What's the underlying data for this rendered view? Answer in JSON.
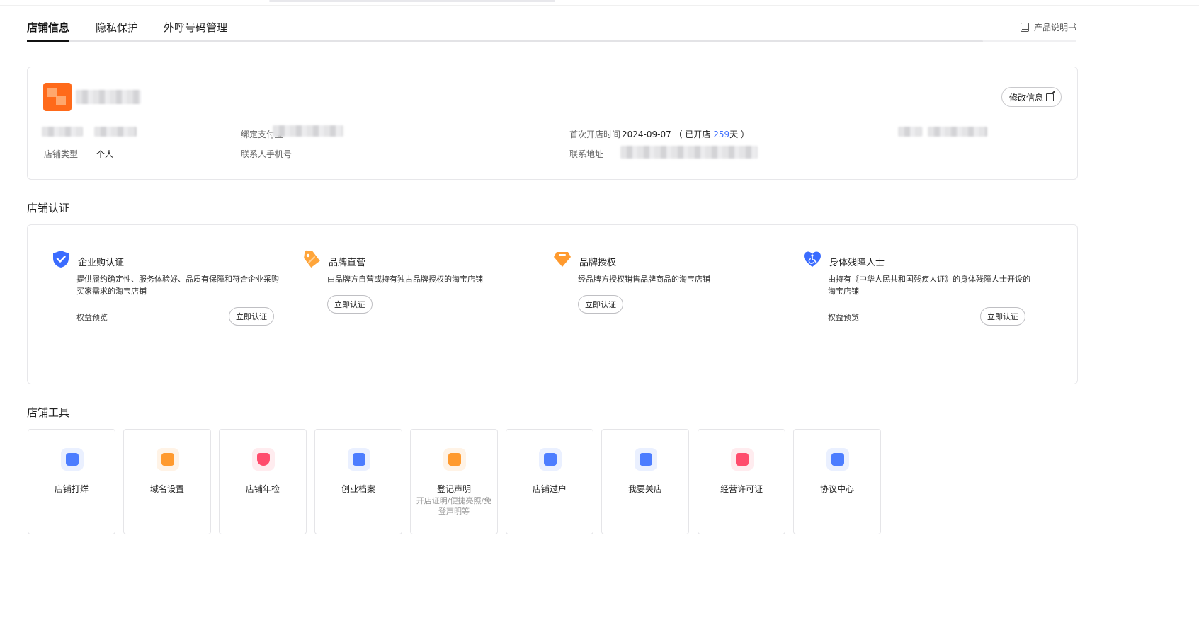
{
  "tabs": {
    "items": [
      {
        "label": "店铺信息"
      },
      {
        "label": "隐私保护"
      },
      {
        "label": "外呼号码管理"
      }
    ],
    "manual_label": "产品说明书"
  },
  "shop_info": {
    "edit_label": "修改信息",
    "bind_alipay_label": "绑定支付宝",
    "first_open_label": "首次开店时间",
    "first_open_date": "2024-09-07",
    "open_prefix": "（ 已开店 ",
    "open_days": "259",
    "open_suffix": "天 ）",
    "shop_type_label": "店铺类型",
    "shop_type_value": "个人",
    "contact_phone_label": "联系人手机号",
    "address_label": "联系地址"
  },
  "certification": {
    "section_title": "店铺认证",
    "items": [
      {
        "title": "企业购认证",
        "desc": "提供履约确定性、服务体验好、品质有保障和符合企业采购买家需求的淘宝店铺",
        "benefit": "权益预览",
        "button": "立即认证",
        "icon": "shield-check-icon",
        "color": "#3b6cff"
      },
      {
        "title": "品牌直营",
        "desc": "由品牌方自营或持有独占品牌授权的淘宝店铺",
        "benefit": "",
        "button": "立即认证",
        "icon": "tag-icon",
        "color": "#ff9a2e"
      },
      {
        "title": "品牌授权",
        "desc": "经品牌方授权销售品牌商品的淘宝店铺",
        "benefit": "",
        "button": "立即认证",
        "icon": "diamond-icon",
        "color": "#ff9a2e"
      },
      {
        "title": "身体残障人士",
        "desc": "由持有《中华人民共和国残疾人证》的身体残障人士开设的淘宝店铺",
        "benefit": "权益预览",
        "button": "立即认证",
        "icon": "accessibility-heart-icon",
        "color": "#3b6cff"
      }
    ]
  },
  "tools": {
    "section_title": "店铺工具",
    "items": [
      {
        "label": "店铺打烊",
        "sub": "",
        "icon": "shop-closed-icon",
        "color": "#4c7dff"
      },
      {
        "label": "域名设置",
        "sub": "",
        "icon": "domain-icon",
        "color": "#ff9a2e"
      },
      {
        "label": "店铺年检",
        "sub": "",
        "icon": "inspection-shield-icon",
        "color": "#ff4d6d"
      },
      {
        "label": "创业档案",
        "sub": "",
        "icon": "archive-icon",
        "color": "#4c7dff"
      },
      {
        "label": "登记声明",
        "sub": "开店证明/便捷亮照/免登声明等",
        "icon": "registration-doc-icon",
        "color": "#ff9a2e"
      },
      {
        "label": "店铺过户",
        "sub": "",
        "icon": "transfer-icon",
        "color": "#4c7dff"
      },
      {
        "label": "我要关店",
        "sub": "",
        "icon": "close-shop-icon",
        "color": "#4c7dff"
      },
      {
        "label": "经营许可证",
        "sub": "",
        "icon": "license-folder-icon",
        "color": "#ff4d6d"
      },
      {
        "label": "协议中心",
        "sub": "",
        "icon": "agreement-icon",
        "color": "#4c7dff"
      }
    ]
  }
}
